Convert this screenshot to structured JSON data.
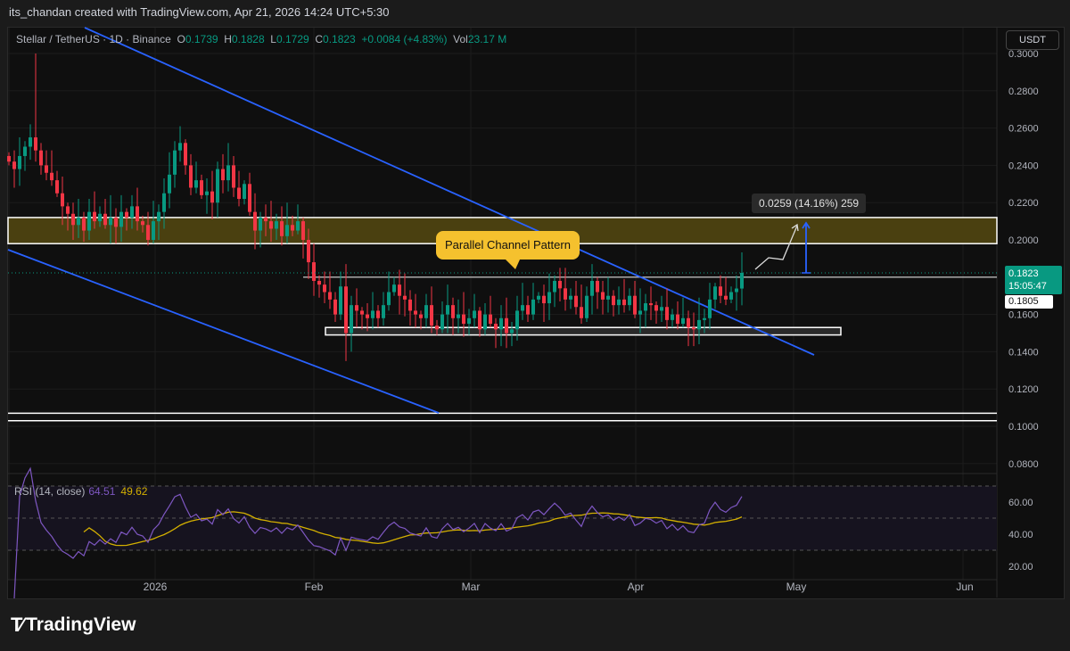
{
  "header": {
    "credit": "its_chandan created with TradingView.com, Apr 21, 2026 14:24 UTC+5:30"
  },
  "legend": {
    "symbol": "Stellar / TetherUS · 1D · Binance",
    "o_label": "O",
    "o": "0.1739",
    "h_label": "H",
    "h": "0.1828",
    "l_label": "L",
    "l": "0.1729",
    "c_label": "C",
    "c": "0.1823",
    "change": "+0.0084 (+4.83%)",
    "vol_label": "Vol",
    "vol": "23.17 M"
  },
  "currency_button": "USDT",
  "price_axis": [
    "0.3000",
    "0.2800",
    "0.2600",
    "0.2400",
    "0.2200",
    "0.2000",
    "0.1600",
    "0.1400",
    "0.1200",
    "0.1000",
    "0.0800"
  ],
  "price_axis_values": [
    0.3,
    0.28,
    0.26,
    0.24,
    0.22,
    0.2,
    0.16,
    0.14,
    0.12,
    0.1,
    0.08
  ],
  "current_price": {
    "value": "0.1823",
    "countdown": "15:05:47"
  },
  "marked_price": "0.1805",
  "time_axis": [
    "2026",
    "Feb",
    "Mar",
    "Apr",
    "May",
    "Jun"
  ],
  "annotations": {
    "callout": "Parallel Channel Pattern",
    "measure": "0.0259 (14.16%) 259"
  },
  "rsi": {
    "label": "RSI (14, close)",
    "value": "64.51",
    "ma": "49.62",
    "axis": [
      "60.00",
      "40.00",
      "20.00"
    ],
    "levels": [
      70,
      50,
      30
    ]
  },
  "logo": "TradingView",
  "colors": {
    "up": "#089981",
    "down": "#f23645",
    "channel": "#2962ff",
    "zone": "#4a4010",
    "rsi": "#7e57c2",
    "rsi_ma": "#d4b000"
  },
  "chart_data": {
    "type": "candlestick",
    "title": "Stellar / TetherUS · 1D · Binance",
    "interval": "1D",
    "start_date": "2025-12-04",
    "close": [
      0.242,
      0.238,
      0.245,
      0.25,
      0.255,
      0.248,
      0.24,
      0.236,
      0.232,
      0.225,
      0.218,
      0.214,
      0.208,
      0.212,
      0.205,
      0.215,
      0.21,
      0.214,
      0.208,
      0.212,
      0.207,
      0.215,
      0.212,
      0.218,
      0.21,
      0.208,
      0.2,
      0.21,
      0.215,
      0.225,
      0.235,
      0.248,
      0.252,
      0.24,
      0.228,
      0.232,
      0.224,
      0.226,
      0.22,
      0.238,
      0.232,
      0.24,
      0.228,
      0.222,
      0.23,
      0.215,
      0.205,
      0.212,
      0.21,
      0.206,
      0.21,
      0.202,
      0.208,
      0.205,
      0.21,
      0.2,
      0.188,
      0.178,
      0.176,
      0.172,
      0.168,
      0.16,
      0.175,
      0.15,
      0.165,
      0.162,
      0.16,
      0.158,
      0.162,
      0.158,
      0.165,
      0.172,
      0.176,
      0.17,
      0.168,
      0.162,
      0.16,
      0.158,
      0.165,
      0.154,
      0.152,
      0.16,
      0.165,
      0.158,
      0.16,
      0.155,
      0.158,
      0.162,
      0.152,
      0.16,
      0.155,
      0.152,
      0.158,
      0.15,
      0.152,
      0.162,
      0.165,
      0.16,
      0.168,
      0.17,
      0.166,
      0.172,
      0.178,
      0.174,
      0.168,
      0.17,
      0.164,
      0.158,
      0.17,
      0.178,
      0.172,
      0.168,
      0.17,
      0.165,
      0.168,
      0.165,
      0.17,
      0.16,
      0.162,
      0.166,
      0.165,
      0.162,
      0.164,
      0.157,
      0.16,
      0.155,
      0.158,
      0.153,
      0.152,
      0.157,
      0.158,
      0.168,
      0.175,
      0.17,
      0.168,
      0.172,
      0.1739,
      0.1823
    ],
    "special_highs": {
      "5": 0.3
    },
    "special_lows": {
      "63": 0.135
    },
    "levels": {
      "resistance_zone": [
        0.198,
        0.212
      ],
      "channel_top": 0.18,
      "support_box": [
        0.149,
        0.153
      ],
      "lower_support": [
        0.103,
        0.107
      ]
    },
    "ylim": [
      0.07,
      0.305
    ]
  }
}
